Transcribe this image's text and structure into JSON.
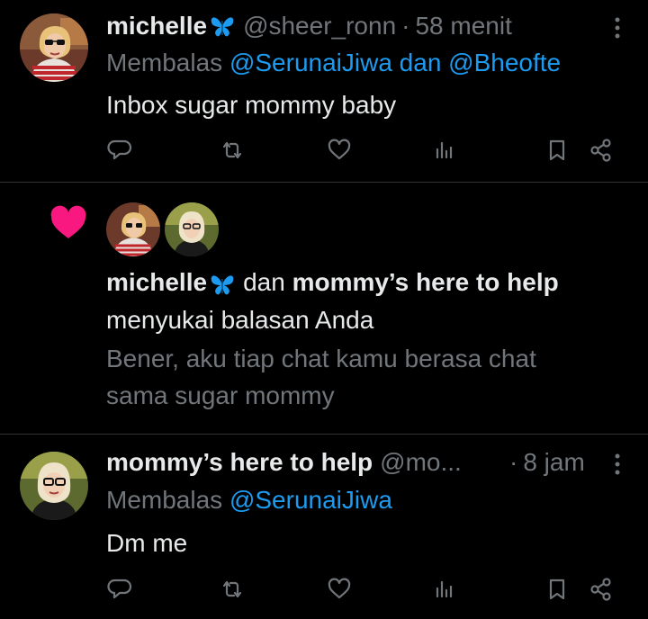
{
  "tweet1": {
    "name": "michelle",
    "handle": "@sheer_ronn",
    "separator": "·",
    "time": "58 menit",
    "reply_prefix": "Membalas",
    "reply_mentions": "@SerunaiJiwa dan @Bheofte",
    "text": "Inbox sugar mommy baby"
  },
  "notification": {
    "user1": "michelle",
    "conjunction": "dan",
    "user2": "mommy’s here to help",
    "action": "menyukai balasan Anda",
    "quoted_line1": "Bener,  aku tiap chat kamu berasa chat",
    "quoted_line2": "sama sugar mommy"
  },
  "tweet2": {
    "name": "mommy’s here to help",
    "handle": "@mo...",
    "separator": "·",
    "time": "8 jam",
    "reply_prefix": "Membalas",
    "reply_mentions": "@SerunaiJiwa",
    "text": "Dm me"
  },
  "icons": {
    "action_bar": [
      "reply-icon",
      "retweet-icon",
      "like-icon",
      "views-icon",
      "bookmark-icon",
      "share-icon"
    ],
    "badge": "butterfly-icon",
    "notification": "heart-icon"
  },
  "colors": {
    "background": "#000000",
    "text": "#e7e9ea",
    "muted": "#71767b",
    "link": "#1d9bf0",
    "heart": "#f91880",
    "badge": "#1d9bf0"
  }
}
